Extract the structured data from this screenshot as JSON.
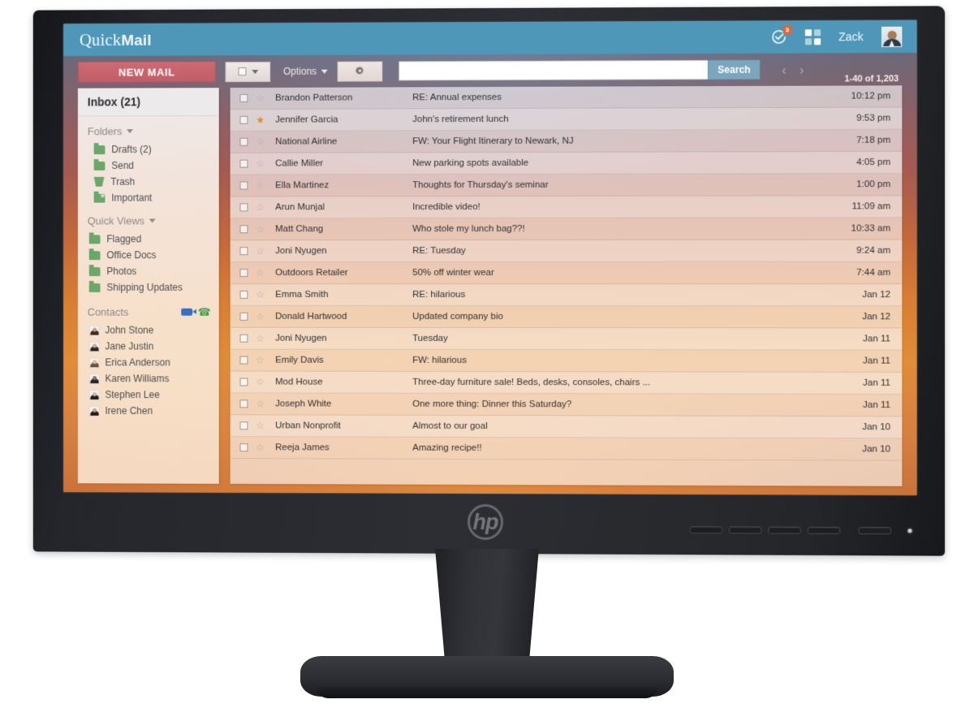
{
  "app": {
    "brand_prefix": "Quick",
    "brand_suffix": "Mail",
    "user_name": "Zack",
    "notify_badge": "3"
  },
  "toolbar": {
    "new_mail_label": "NEW MAIL",
    "options_label": "Options",
    "search_placeholder": "",
    "search_value": "",
    "search_button_label": "Search",
    "prev_label": "‹",
    "next_label": "›",
    "count_label": "1-40 of 1,203"
  },
  "sidebar": {
    "inbox_label": "Inbox (21)",
    "folders_label": "Folders",
    "folders": [
      {
        "label": "Drafts (2)",
        "icon": "folder-icon"
      },
      {
        "label": "Send",
        "icon": "folder-icon"
      },
      {
        "label": "Trash",
        "icon": "trash-icon"
      },
      {
        "label": "Important",
        "icon": "folder-star-icon"
      }
    ],
    "quick_views_label": "Quick Views",
    "quick_views": [
      {
        "label": "Flagged",
        "icon": "folder-icon"
      },
      {
        "label": "Office Docs",
        "icon": "folder-icon"
      },
      {
        "label": "Photos",
        "icon": "folder-icon"
      },
      {
        "label": "Shipping Updates",
        "icon": "folder-icon"
      }
    ],
    "contacts_label": "Contacts",
    "contacts": [
      {
        "name": "John Stone",
        "hair": "#3b2a20",
        "skin": "#c79a75"
      },
      {
        "name": "Jane Justin",
        "hair": "#2b2622",
        "skin": "#d2a582"
      },
      {
        "name": "Erica Anderson",
        "hair": "#6d5337",
        "skin": "#e0b68f"
      },
      {
        "name": "Karen Williams",
        "hair": "#22272e",
        "skin": "#8e6a4e"
      },
      {
        "name": "Stephen Lee",
        "hair": "#1b1f24",
        "skin": "#d9b28c"
      },
      {
        "name": "Irene Chen",
        "hair": "#241a16",
        "skin": "#c99a74"
      }
    ]
  },
  "messages": [
    {
      "starred": false,
      "sender": "Brandon Patterson",
      "subject": "RE: Annual expenses",
      "time": "10:12 pm"
    },
    {
      "starred": true,
      "sender": "Jennifer Garcia",
      "subject": "John's retirement lunch",
      "time": "9:53 pm"
    },
    {
      "starred": false,
      "sender": "National Airline",
      "subject": "FW: Your Flight Itinerary to Newark, NJ",
      "time": "7:18 pm"
    },
    {
      "starred": false,
      "sender": "Callie Miller",
      "subject": "New parking spots available",
      "time": "4:05 pm"
    },
    {
      "starred": false,
      "sender": "Ella Martinez",
      "subject": "Thoughts for Thursday's seminar",
      "time": "1:00 pm"
    },
    {
      "starred": false,
      "sender": "Arun Munjal",
      "subject": "Incredible video!",
      "time": "11:09 am"
    },
    {
      "starred": false,
      "sender": "Matt Chang",
      "subject": "Who stole my lunch bag??!",
      "time": "10:33 am"
    },
    {
      "starred": false,
      "sender": "Joni Nyugen",
      "subject": "RE: Tuesday",
      "time": "9:24 am"
    },
    {
      "starred": false,
      "sender": "Outdoors Retailer",
      "subject": "50% off winter wear",
      "time": "7:44 am"
    },
    {
      "starred": false,
      "sender": "Emma Smith",
      "subject": "RE: hilarious",
      "time": "Jan 12"
    },
    {
      "starred": false,
      "sender": "Donald Hartwood",
      "subject": "Updated company bio",
      "time": "Jan 12"
    },
    {
      "starred": false,
      "sender": "Joni Nyugen",
      "subject": "Tuesday",
      "time": "Jan 11"
    },
    {
      "starred": false,
      "sender": "Emily Davis",
      "subject": "FW: hilarious",
      "time": "Jan 11"
    },
    {
      "starred": false,
      "sender": "Mod House",
      "subject": "Three-day furniture sale! Beds, desks, consoles, chairs ...",
      "time": "Jan 11"
    },
    {
      "starred": false,
      "sender": "Joseph White",
      "subject": "One more thing: Dinner this Saturday?",
      "time": "Jan 11"
    },
    {
      "starred": false,
      "sender": "Urban Nonprofit",
      "subject": "Almost to our goal",
      "time": "Jan 10"
    },
    {
      "starred": false,
      "sender": "Reeja James",
      "subject": "Amazing recipe!!",
      "time": "Jan 10"
    }
  ],
  "hardware": {
    "logo_text": "hp",
    "osd_button_count": 5
  },
  "colors": {
    "appbar": "#4e97b8",
    "new_mail": "#c05d67",
    "search_button": "#7aa7bd",
    "folder_green": "#6aa86a",
    "star_on": "#e08a22"
  }
}
